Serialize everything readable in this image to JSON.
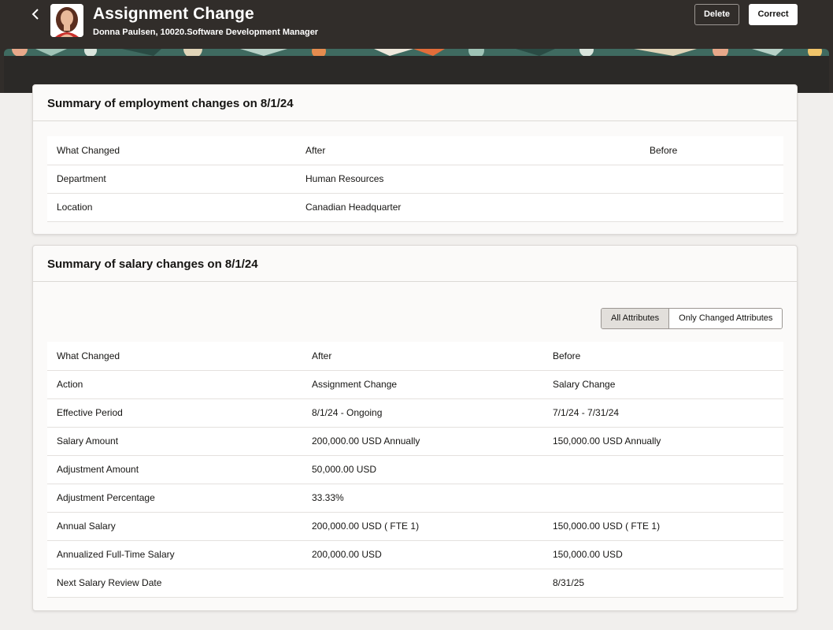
{
  "header": {
    "title": "Assignment Change",
    "subtitle": "Donna Paulsen, 10020.Software Development Manager",
    "delete_label": "Delete",
    "correct_label": "Correct"
  },
  "employment": {
    "title": "Summary of employment changes on 8/1/24",
    "columns": [
      "What Changed",
      "After",
      "Before"
    ],
    "rows": [
      [
        "Department",
        "Human Resources",
        ""
      ],
      [
        "Location",
        "Canadian Headquarter",
        ""
      ]
    ]
  },
  "salary": {
    "title": "Summary of salary changes on 8/1/24",
    "toggle": [
      "All Attributes",
      "Only Changed Attributes"
    ],
    "toggle_selected": "All Attributes",
    "columns": [
      "What Changed",
      "After",
      "Before"
    ],
    "rows": [
      [
        "Action",
        "Assignment Change",
        "Salary Change"
      ],
      [
        "Effective Period",
        "8/1/24 - Ongoing",
        "7/1/24 - 7/31/24"
      ],
      [
        "Salary Amount",
        "200,000.00 USD Annually",
        "150,000.00 USD Annually"
      ],
      [
        "Adjustment Amount",
        "50,000.00 USD",
        ""
      ],
      [
        "Adjustment Percentage",
        "33.33%",
        ""
      ],
      [
        "Annual Salary",
        "200,000.00 USD ( FTE 1)",
        "150,000.00 USD ( FTE 1)"
      ],
      [
        "Annualized Full-Time Salary",
        "200,000.00 USD",
        "150,000.00 USD"
      ],
      [
        "Next Salary Review Date",
        "",
        "8/31/25"
      ]
    ]
  },
  "colors": {
    "header_bg": "#312d2a",
    "page_bg": "#f1efed",
    "card_bg": "#fbfaf9"
  }
}
